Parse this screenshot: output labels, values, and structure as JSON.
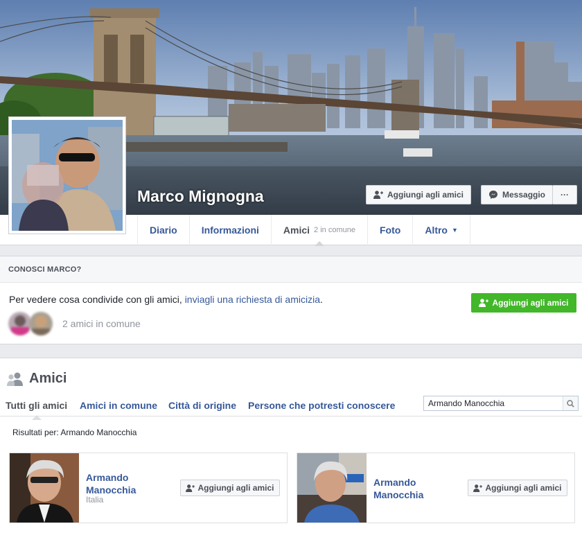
{
  "profile": {
    "name": "Marco Mignogna",
    "add_friend_label": "Aggiungi agli amici",
    "message_label": "Messaggio",
    "more_label": "···"
  },
  "nav": {
    "tabs": [
      {
        "label": "Diario"
      },
      {
        "label": "Informazioni"
      },
      {
        "label": "Amici",
        "sub": "2 in comune"
      },
      {
        "label": "Foto"
      },
      {
        "label": "Altro",
        "caret": "▼"
      }
    ]
  },
  "know": {
    "header": "CONOSCI MARCO?",
    "text": "Per vedere cosa condivide con gli amici, ",
    "link": "inviagli una richiesta di amicizia",
    "text_end": ".",
    "mutual_count": "2 amici in comune",
    "add_friend_label": "Aggiungi agli amici"
  },
  "friends": {
    "title": "Amici",
    "tabs": [
      "Tutti gli amici",
      "Amici in comune",
      "Città di origine",
      "Persone che potresti conoscere"
    ],
    "search_value": "Armando Manocchia",
    "results_label": "Risultati per: Armando Manocchia",
    "results": [
      {
        "name_line1": "Armando",
        "name_line2": "Manocchia",
        "location": "Italia",
        "button": "Aggiungi agli amici"
      },
      {
        "name_line1": "Armando",
        "name_line2": "Manocchia",
        "location": "",
        "button": "Aggiungi agli amici"
      }
    ]
  },
  "colors": {
    "link_blue": "#365899",
    "green_button": "#42b72a",
    "text_gray": "#4b4f56",
    "muted_gray": "#90949c"
  }
}
